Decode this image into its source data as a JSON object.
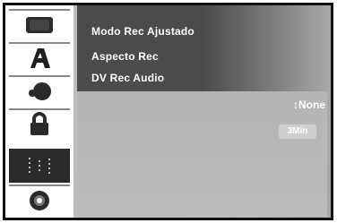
{
  "sidebar": {
    "items": [
      {
        "icon": "disc-menu-icon"
      },
      {
        "icon": "letter-a-icon"
      },
      {
        "icon": "audio-speaker-icon"
      },
      {
        "icon": "padlock-icon"
      },
      {
        "icon": "recording-settings-icon"
      },
      {
        "icon": "dvd-disc-icon"
      }
    ]
  },
  "menu": {
    "items": [
      {
        "label": "Modo Rec Ajustado"
      },
      {
        "label": "Aspecto Rec"
      },
      {
        "label": "DV Rec Audio"
      }
    ]
  },
  "option": {
    "value": "↕None"
  },
  "sub_option": {
    "label": "3Min"
  }
}
